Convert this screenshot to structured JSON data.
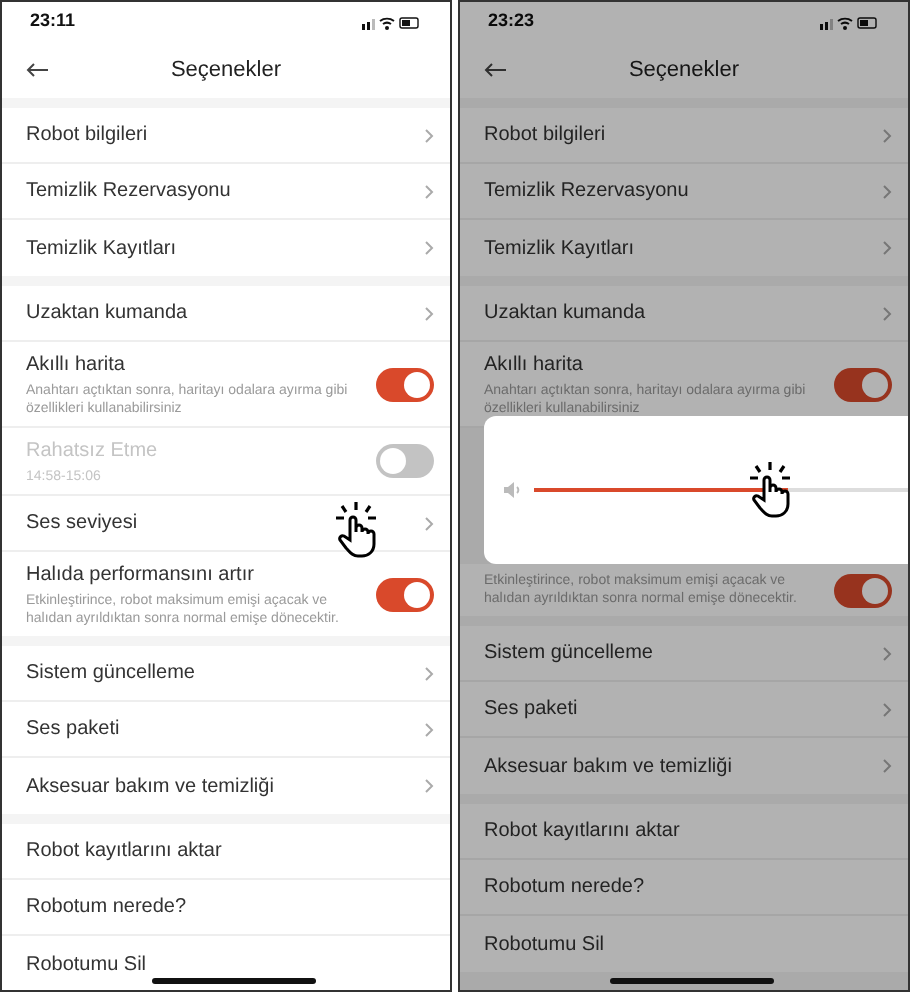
{
  "screens": [
    {
      "time": "23:11",
      "title": "Seçenekler",
      "dimmed": false,
      "sections": [
        [
          {
            "kind": "link",
            "label": "Robot bilgileri"
          },
          {
            "kind": "link",
            "label": "Temizlik Rezervasyonu"
          },
          {
            "kind": "link",
            "label": "Temizlik Kayıtları"
          }
        ],
        [
          {
            "kind": "link",
            "label": "Uzaktan kumanda"
          },
          {
            "kind": "toggle",
            "label": "Akıllı harita",
            "description": "Anahtarı açtıktan sonra, haritayı odalara ayırma gibi özellikleri kullanabilirsiniz",
            "on": true,
            "disabled": false
          },
          {
            "kind": "toggle",
            "label": "Rahatsız Etme",
            "description": "14:58-15:06",
            "on": false,
            "disabled": true
          },
          {
            "kind": "link",
            "label": "Ses seviyesi",
            "tap": true
          },
          {
            "kind": "toggle",
            "label": "Halıda performansını artır",
            "description": "Etkinleştirince, robot maksimum emişi açacak ve halıdan ayrıldıktan sonra normal emişe dönecektir.",
            "on": true,
            "disabled": false
          }
        ],
        [
          {
            "kind": "link",
            "label": "Sistem güncelleme"
          },
          {
            "kind": "link",
            "label": "Ses paketi"
          },
          {
            "kind": "link",
            "label": "Aksesuar bakım ve temizliği"
          }
        ],
        [
          {
            "kind": "plain",
            "label": "Robot kayıtlarını aktar"
          },
          {
            "kind": "plain",
            "label": "Robotum nerede?"
          },
          {
            "kind": "plain",
            "label": "Robotumu Sil"
          }
        ]
      ]
    },
    {
      "time": "23:23",
      "title": "Seçenekler",
      "dimmed": true,
      "sections": [
        [
          {
            "kind": "link",
            "label": "Robot bilgileri"
          },
          {
            "kind": "link",
            "label": "Temizlik Rezervasyonu"
          },
          {
            "kind": "link",
            "label": "Temizlik Kayıtları"
          }
        ],
        [
          {
            "kind": "link",
            "label": "Uzaktan kumanda"
          },
          {
            "kind": "toggle",
            "label": "Akıllı harita",
            "description": "Anahtarı açtıktan sonra, haritayı odalara ayırma gibi özellikleri kullanabilirsiniz",
            "on": true,
            "disabled": false
          },
          {
            "kind": "volume",
            "level": 0.68,
            "tap": true
          },
          {
            "kind": "toggle",
            "description": "Etkinleştirince, robot maksimum emişi açacak ve halıdan ayrıldıktan sonra normal emişe dönecektir.",
            "on": true,
            "disabled": false
          }
        ],
        [
          {
            "kind": "link",
            "label": "Sistem güncelleme"
          },
          {
            "kind": "link",
            "label": "Ses paketi"
          },
          {
            "kind": "link",
            "label": "Aksesuar bakım ve temizliği"
          }
        ],
        [
          {
            "kind": "plain",
            "label": "Robot kayıtlarını aktar"
          },
          {
            "kind": "plain",
            "label": "Robotum nerede?"
          },
          {
            "kind": "plain",
            "label": "Robotumu Sil"
          }
        ]
      ]
    }
  ]
}
